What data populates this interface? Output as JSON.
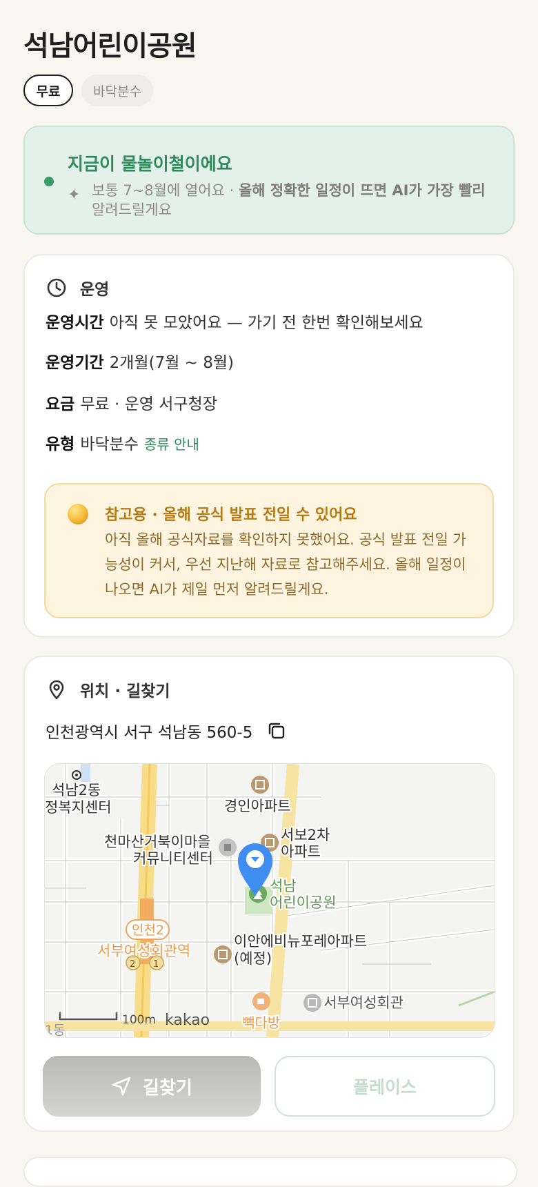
{
  "park": {
    "name": "석남어린이공원",
    "chips": [
      "무료",
      "바닥분수"
    ]
  },
  "season": {
    "headline": "지금이 물놀이철이에요",
    "note_plain": "보통 7~8월에 열어요 · ",
    "note_bold": "올해 정확한 일정이 뜨면 AI가 가장 빨리",
    "note_tail": "알려드릴게요"
  },
  "operation": {
    "section_title": "운영",
    "rows": [
      {
        "label": "운영시간",
        "value": "아직 못 모았어요 — 가기 전 한번 확인해보세요"
      },
      {
        "label": "운영기간",
        "value": "2개월(7월 ~ 8월)"
      },
      {
        "label": "요금",
        "value": "무료 · 운영 서구청장"
      },
      {
        "label": "유형",
        "value": "바닥분수",
        "link": "종류 안내"
      }
    ],
    "notice": {
      "title": "참고용 · 올해 공식 발표 전일 수 있어요",
      "body": "아직 올해 공식자료를 확인하지 못했어요. 공식 발표 전일 가능성이 커서, 우선 지난해 자료로 참고해주세요. 올해 일정이 나오면 AI가 제일 먼저 알려드릴게요."
    }
  },
  "location": {
    "section_title": "위치 · 길찾기",
    "address": "인천광역시 서구 석남동 560-5",
    "map_labels": {
      "welfare_line1": "석남2동",
      "welfare_line2": "정복지센터",
      "apt1": "경인아파트",
      "community_line1": "천마산거북이마을",
      "community_line2": "커뮤니티센터",
      "apt2_line1": "서보2차",
      "apt2_line2": "아파트",
      "park_line1": "석남",
      "park_line2": "어린이공원",
      "line_badge": "인천2",
      "station": "서부여성회관역",
      "exit2": "2",
      "exit1": "1",
      "apt3_line1": "이안에비뉴포레아파트",
      "apt3_line2": "(예정)",
      "hall": "서부여성회관",
      "cafe": "빽다방",
      "dong": "1동",
      "scale": "100m",
      "brand": "kakao"
    },
    "buttons": {
      "route": "길찾기",
      "place": "플레이스"
    }
  },
  "colors": {
    "accent_green": "#2e8a5c",
    "notice_gold": "#b47a16",
    "pin_blue": "#3f8df0"
  }
}
